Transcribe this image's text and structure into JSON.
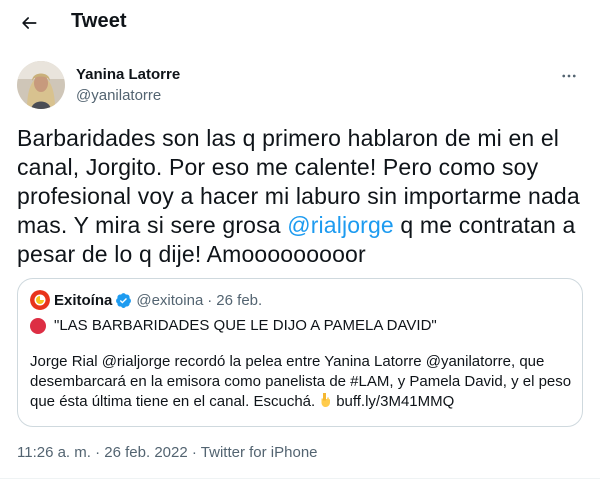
{
  "header": {
    "title": "Tweet"
  },
  "author": {
    "name": "Yanina Latorre",
    "handle": "@yanilatorre"
  },
  "tweet": {
    "lines": [
      "Barbaridades son las q primero hablaron de mi en el",
      "canal, Jorgito. Por eso me calente! Pero como soy",
      "profesional voy a hacer mi laburo sin importarme nada",
      "mas. Y mira si sere grosa ",
      "@rialjorge",
      " q me contratan a",
      "pesar de lo q dije! Amooooooooor"
    ]
  },
  "quote": {
    "name": "Exitoína",
    "handle": "@exitoina",
    "separator": "·",
    "date": "26 feb.",
    "headline": "\"LAS BARBARIDADES QUE LE DIJO A PAMELA DAVID\"",
    "body_lines": [
      "Jorge Rial @rialjorge recordó la pelea entre Yanina Latorre @yanilatorre, que",
      "desembarcará en la emisora como panelista de #LAM, y Pamela David, y el peso",
      "que ésta última tiene en el canal. Escuchá."
    ],
    "link": "buff.ly/3M41MMQ"
  },
  "meta": {
    "time": "11:26 a. m.",
    "sep1": "·",
    "date": "26 feb. 2022",
    "sep2": "·",
    "source": "Twitter for iPhone"
  },
  "colors": {
    "accent": "#1d9bf0",
    "secondary": "#536471",
    "border": "#cfd9de",
    "alert_red": "#dd2e44"
  },
  "icons": [
    "back-arrow-icon",
    "more-icon",
    "verified-badge-icon",
    "red-circle-icon",
    "backhand-index-down-icon"
  ]
}
